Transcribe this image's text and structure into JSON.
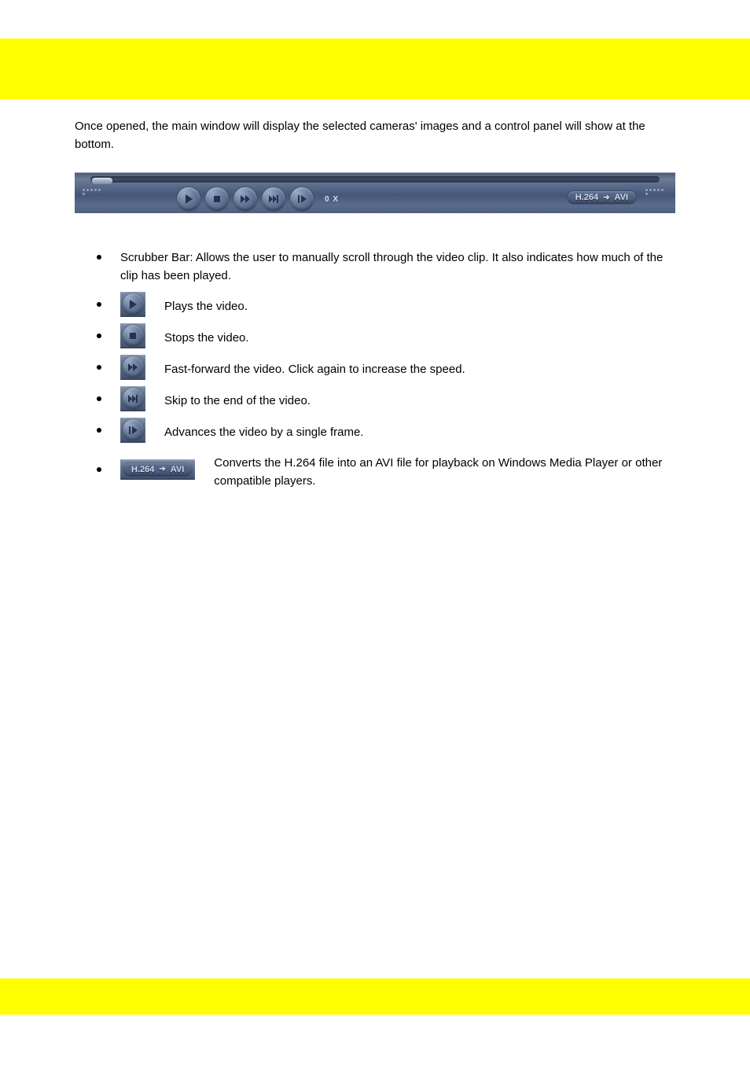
{
  "intro": "Once opened, the main window will display the selected cameras' images and a control panel will show at the bottom.",
  "player": {
    "speed": "0 X",
    "buttons": {
      "play": "play-icon",
      "stop": "stop-icon",
      "fast_forward": "fast-forward-icon",
      "skip_end": "skip-end-icon",
      "frame_step": "frame-step-icon"
    },
    "codec": {
      "left": "H.264",
      "right": "AVI"
    }
  },
  "bullets": [
    {
      "type": "text",
      "text": "Scrubber Bar: Allows the user to manually scroll through the video clip. It also indicates how much of the clip has been played."
    },
    {
      "type": "icon",
      "icon": "play",
      "text": "Plays the video."
    },
    {
      "type": "icon",
      "icon": "stop",
      "text": "Stops the video."
    },
    {
      "type": "icon",
      "icon": "fast_forward",
      "text": "Fast-forward the video. Click again to increase the speed."
    },
    {
      "type": "icon",
      "icon": "skip_end",
      "text": "Skip to the end of the video."
    },
    {
      "type": "icon",
      "icon": "frame_step",
      "text": "Advances the video by a single frame."
    },
    {
      "type": "codec",
      "text": "Converts the H.264 file into an AVI file for playback on Windows Media Player or other compatible players."
    }
  ]
}
